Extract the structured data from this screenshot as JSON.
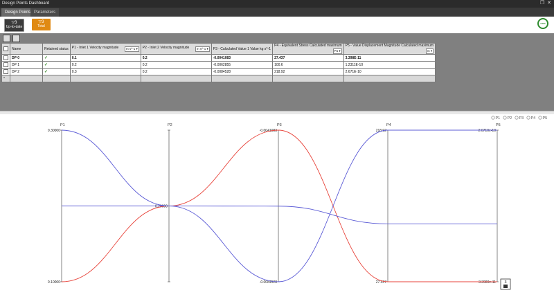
{
  "window": {
    "title": "Design Points Dashboard"
  },
  "tabs": [
    {
      "label": "Design Points"
    },
    {
      "label": "Parameters"
    }
  ],
  "toolbar": {
    "uptodate": {
      "count": "▽3",
      "label": "Up-to-date"
    },
    "total": {
      "count": "▽3",
      "label": "Total"
    },
    "progress_label": "100%"
  },
  "table": {
    "headers": {
      "name": "Name",
      "retained": "Retained status",
      "p1": "P1 - Inlet 1 Velocity magnitude",
      "p1_unit": "m s^-1 ▾",
      "p2": "P2 - Inlet 2 Velocity magnitude",
      "p2_unit": "m s^-1 ▾",
      "p3": "P3 - Calculated Value 1 Value kg s^-1",
      "p4": "P4 - Equivalent Stress Calculated maximum",
      "p4_unit": "Pa ▾",
      "p5": "P5 - Value Displacement Magnitude Calculated maximum",
      "p5_unit": "m ▾"
    },
    "rows": [
      {
        "name": "DP 0",
        "p1": "0.1",
        "p2": "0.2",
        "p3": "-0.0041083",
        "p4": "27.437",
        "p5": "3.398E-11"
      },
      {
        "name": "DP 1",
        "p1": "0.2",
        "p2": "0.2",
        "p3": "-0.0062855",
        "p4": "100.6",
        "p5": "1.2311E-10"
      },
      {
        "name": "DP 2",
        "p1": "0.3",
        "p2": "0.2",
        "p3": "-0.0084528",
        "p4": "218.92",
        "p5": "2.671E-10"
      }
    ],
    "new_row_marker": "*"
  },
  "chart_data": {
    "type": "line",
    "subtype": "parallel-coordinates",
    "legend": [
      "P1",
      "P2",
      "P3",
      "P4",
      "P5"
    ],
    "legend_position": "top-right",
    "axes": [
      {
        "name": "P1",
        "top_label": "0.30000",
        "bottom_label": "0.10000",
        "max": 0.3,
        "min": 0.1
      },
      {
        "name": "P2",
        "mid_label": "0.20000",
        "max": 0.3,
        "min": 0.1
      },
      {
        "name": "P3",
        "top_label": "-0.0041083",
        "bottom_label": "-0.0084528",
        "max": -0.0041083,
        "min": -0.0084528
      },
      {
        "name": "P4",
        "top_label": "218.92",
        "bottom_label": "27.437",
        "max": 218.92,
        "min": 27.437
      },
      {
        "name": "P5",
        "top_label": "2.6710e-10",
        "bottom_label": "3.3980e-11",
        "max": 2.671e-10,
        "min": 3.398e-11
      }
    ],
    "series": [
      {
        "values": [
          0.1,
          0.2,
          -0.0041083,
          27.437,
          3.398e-11
        ],
        "color": "#e8453c"
      },
      {
        "values": [
          0.2,
          0.2,
          -0.0062855,
          100.6,
          1.2311e-10
        ],
        "color": "#5b5bd6"
      },
      {
        "values": [
          0.3,
          0.2,
          -0.0084528,
          218.92,
          2.671e-10
        ],
        "color": "#5b5bd6"
      }
    ],
    "count_badge": "3"
  },
  "colors": {
    "accent": "#e08a13",
    "ok": "#2e8b2e",
    "series_red": "#e8453c",
    "series_blue": "#5b5bd6"
  }
}
